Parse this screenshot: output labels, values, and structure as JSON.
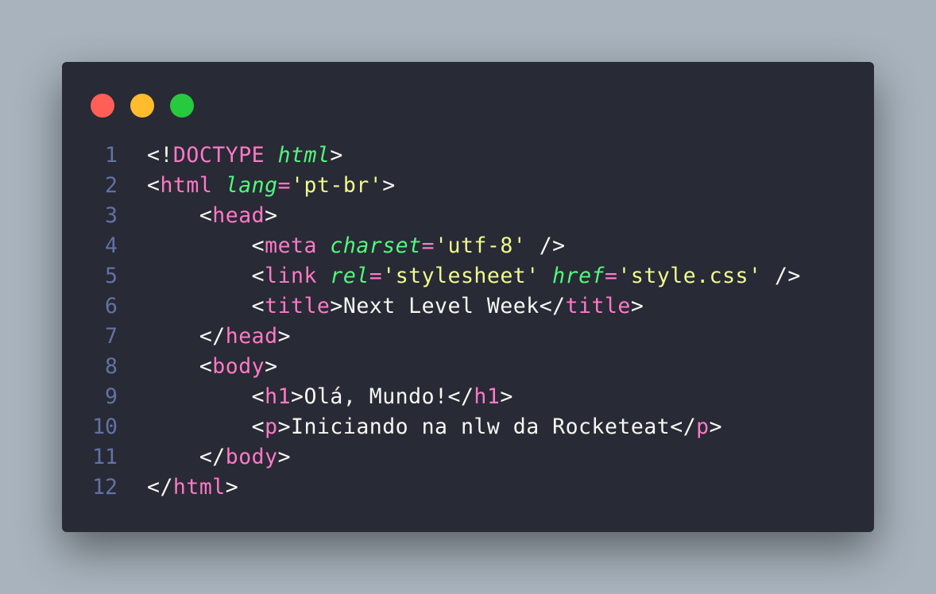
{
  "window": {
    "buttons": [
      {
        "name": "close",
        "color": "#ff5f56"
      },
      {
        "name": "minimize",
        "color": "#ffbd2e"
      },
      {
        "name": "maximize",
        "color": "#27c93f"
      }
    ]
  },
  "colors": {
    "background": "#282a36",
    "line_number": "#6272a4",
    "punct": "#f8f8f2",
    "tag": "#ff79c6",
    "attr": "#50fa7b",
    "string": "#f1fa8c",
    "text": "#f8f8f2"
  },
  "code": {
    "lines": [
      {
        "number": "1",
        "tokens": [
          {
            "t": "punct",
            "v": "<!"
          },
          {
            "t": "tag",
            "v": "DOCTYPE"
          },
          {
            "t": "text",
            "v": " "
          },
          {
            "t": "attr",
            "v": "html"
          },
          {
            "t": "punct",
            "v": ">"
          }
        ]
      },
      {
        "number": "2",
        "tokens": [
          {
            "t": "punct",
            "v": "<"
          },
          {
            "t": "tag",
            "v": "html"
          },
          {
            "t": "text",
            "v": " "
          },
          {
            "t": "attr",
            "v": "lang"
          },
          {
            "t": "eq",
            "v": "="
          },
          {
            "t": "str",
            "v": "'pt-br'"
          },
          {
            "t": "punct",
            "v": ">"
          }
        ]
      },
      {
        "number": "3",
        "tokens": [
          {
            "t": "text",
            "v": "    "
          },
          {
            "t": "punct",
            "v": "<"
          },
          {
            "t": "tag",
            "v": "head"
          },
          {
            "t": "punct",
            "v": ">"
          }
        ]
      },
      {
        "number": "4",
        "tokens": [
          {
            "t": "text",
            "v": "        "
          },
          {
            "t": "punct",
            "v": "<"
          },
          {
            "t": "tag",
            "v": "meta"
          },
          {
            "t": "text",
            "v": " "
          },
          {
            "t": "attr",
            "v": "charset"
          },
          {
            "t": "eq",
            "v": "="
          },
          {
            "t": "str",
            "v": "'utf-8'"
          },
          {
            "t": "text",
            "v": " "
          },
          {
            "t": "punct",
            "v": "/>"
          }
        ]
      },
      {
        "number": "5",
        "tokens": [
          {
            "t": "text",
            "v": "        "
          },
          {
            "t": "punct",
            "v": "<"
          },
          {
            "t": "tag",
            "v": "link"
          },
          {
            "t": "text",
            "v": " "
          },
          {
            "t": "attr",
            "v": "rel"
          },
          {
            "t": "eq",
            "v": "="
          },
          {
            "t": "str",
            "v": "'stylesheet'"
          },
          {
            "t": "text",
            "v": " "
          },
          {
            "t": "attr",
            "v": "href"
          },
          {
            "t": "eq",
            "v": "="
          },
          {
            "t": "str",
            "v": "'style.css'"
          },
          {
            "t": "text",
            "v": " "
          },
          {
            "t": "punct",
            "v": "/>"
          }
        ]
      },
      {
        "number": "6",
        "tokens": [
          {
            "t": "text",
            "v": "        "
          },
          {
            "t": "punct",
            "v": "<"
          },
          {
            "t": "tag",
            "v": "title"
          },
          {
            "t": "punct",
            "v": ">"
          },
          {
            "t": "text",
            "v": "Next Level Week"
          },
          {
            "t": "punct",
            "v": "</"
          },
          {
            "t": "tag",
            "v": "title"
          },
          {
            "t": "punct",
            "v": ">"
          }
        ]
      },
      {
        "number": "7",
        "tokens": [
          {
            "t": "text",
            "v": "    "
          },
          {
            "t": "punct",
            "v": "</"
          },
          {
            "t": "tag",
            "v": "head"
          },
          {
            "t": "punct",
            "v": ">"
          }
        ]
      },
      {
        "number": "8",
        "tokens": [
          {
            "t": "text",
            "v": "    "
          },
          {
            "t": "punct",
            "v": "<"
          },
          {
            "t": "tag",
            "v": "body"
          },
          {
            "t": "punct",
            "v": ">"
          }
        ]
      },
      {
        "number": "9",
        "tokens": [
          {
            "t": "text",
            "v": "        "
          },
          {
            "t": "punct",
            "v": "<"
          },
          {
            "t": "tag",
            "v": "h1"
          },
          {
            "t": "punct",
            "v": ">"
          },
          {
            "t": "text",
            "v": "Olá, Mundo!"
          },
          {
            "t": "punct",
            "v": "</"
          },
          {
            "t": "tag",
            "v": "h1"
          },
          {
            "t": "punct",
            "v": ">"
          }
        ]
      },
      {
        "number": "10",
        "tokens": [
          {
            "t": "text",
            "v": "        "
          },
          {
            "t": "punct",
            "v": "<"
          },
          {
            "t": "tag",
            "v": "p"
          },
          {
            "t": "punct",
            "v": ">"
          },
          {
            "t": "text",
            "v": "Iniciando na nlw da Rocketeat"
          },
          {
            "t": "punct",
            "v": "</"
          },
          {
            "t": "tag",
            "v": "p"
          },
          {
            "t": "punct",
            "v": ">"
          }
        ]
      },
      {
        "number": "11",
        "tokens": [
          {
            "t": "text",
            "v": "    "
          },
          {
            "t": "punct",
            "v": "</"
          },
          {
            "t": "tag",
            "v": "body"
          },
          {
            "t": "punct",
            "v": ">"
          }
        ]
      },
      {
        "number": "12",
        "tokens": [
          {
            "t": "punct",
            "v": "</"
          },
          {
            "t": "tag",
            "v": "html"
          },
          {
            "t": "punct",
            "v": ">"
          }
        ]
      }
    ]
  }
}
